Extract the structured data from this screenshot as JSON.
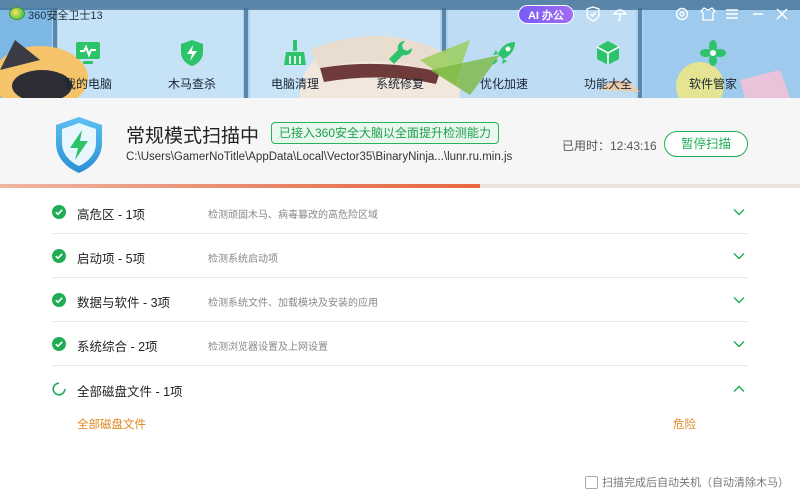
{
  "app": {
    "title": "360安全卫士13",
    "ai_label": "AI 办公"
  },
  "nav": {
    "items": [
      {
        "label": "我的电脑",
        "icon": "monitor-pulse-icon"
      },
      {
        "label": "木马查杀",
        "icon": "shield-bolt-icon"
      },
      {
        "label": "电脑清理",
        "icon": "broom-icon"
      },
      {
        "label": "系统修复",
        "icon": "wrench-icon"
      },
      {
        "label": "优化加速",
        "icon": "rocket-icon"
      },
      {
        "label": "功能大全",
        "icon": "cube-icon"
      },
      {
        "label": "软件管家",
        "icon": "flower-grid-icon"
      }
    ]
  },
  "scan": {
    "title": "常规模式扫描中",
    "badge": "已接入360安全大脑以全面提升检测能力",
    "path": "C:\\Users\\GamerNoTitle\\AppData\\Local\\Vector35\\BinaryNinja...\\lunr.ru.min.js",
    "elapsed": "已用时：12:43:16",
    "pause_label": "暂停扫描",
    "progress": 0.6
  },
  "categories": [
    {
      "name": "高危区 -  1项",
      "desc": "检测顽固木马、病毒篡改的高危险区域",
      "status": "done"
    },
    {
      "name": "启动项 -  5项",
      "desc": "检测系统启动项",
      "status": "done"
    },
    {
      "name": "数据与软件 -  3项",
      "desc": "检测系统文件、加载模块及安装的应用",
      "status": "done"
    },
    {
      "name": "系统综合 -  2项",
      "desc": "检测浏览器设置及上网设置",
      "status": "done"
    },
    {
      "name": "全部磁盘文件 -  1项",
      "desc": "",
      "status": "scanning"
    }
  ],
  "detail": {
    "item": "全部磁盘文件",
    "risk": "危险"
  },
  "footer": {
    "auto_shutdown": "扫描完成后自动关机（自动清除木马）"
  },
  "colors": {
    "accent_green": "#1fae54",
    "warning_orange": "#e0861c",
    "progress_red": "#e8673f"
  }
}
